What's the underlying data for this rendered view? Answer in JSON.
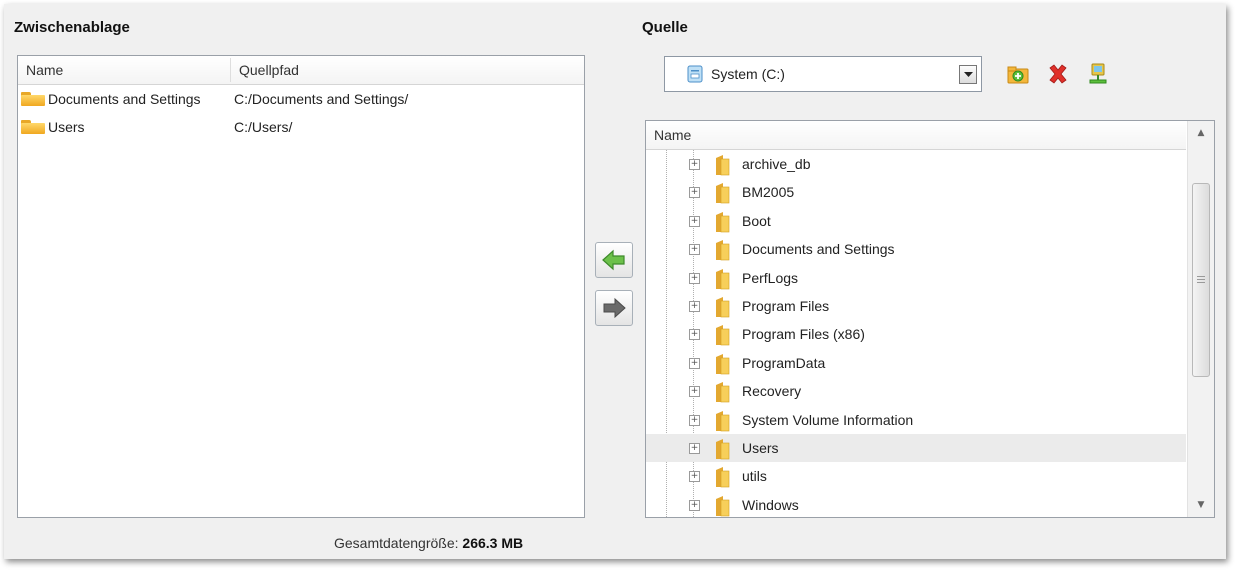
{
  "clipboard": {
    "title": "Zwischenablage",
    "columns": [
      "Name",
      "Quellpfad"
    ],
    "rows": [
      {
        "name": "Documents and Settings",
        "path": "C:/Documents and Settings/"
      },
      {
        "name": "Users",
        "path": "C:/Users/"
      }
    ],
    "total_label": "Gesamtdatengröße:",
    "total_value": "266.3 MB"
  },
  "transfer": {
    "add_icon": "arrow-left-icon",
    "remove_icon": "arrow-right-icon"
  },
  "source": {
    "title": "Quelle",
    "drive_value": "System (C:)",
    "toolbar_icons": [
      "add-folder-icon",
      "delete-icon",
      "network-drive-icon"
    ],
    "tree_header": "Name",
    "items": [
      {
        "label": "archive_db",
        "selected": false
      },
      {
        "label": "BM2005",
        "selected": false
      },
      {
        "label": "Boot",
        "selected": false
      },
      {
        "label": "Documents and Settings",
        "selected": false
      },
      {
        "label": "PerfLogs",
        "selected": false
      },
      {
        "label": "Program Files",
        "selected": false
      },
      {
        "label": "Program Files (x86)",
        "selected": false
      },
      {
        "label": "ProgramData",
        "selected": false
      },
      {
        "label": "Recovery",
        "selected": false
      },
      {
        "label": "System Volume Information",
        "selected": false
      },
      {
        "label": "Users",
        "selected": true
      },
      {
        "label": "utils",
        "selected": false
      },
      {
        "label": "Windows",
        "selected": false
      }
    ]
  },
  "colors": {
    "panel_bg": "#f0f0f0",
    "folder_yellow": "#f5c040",
    "arrow_green": "#6cc04a",
    "selected_row": "#ebebeb"
  }
}
